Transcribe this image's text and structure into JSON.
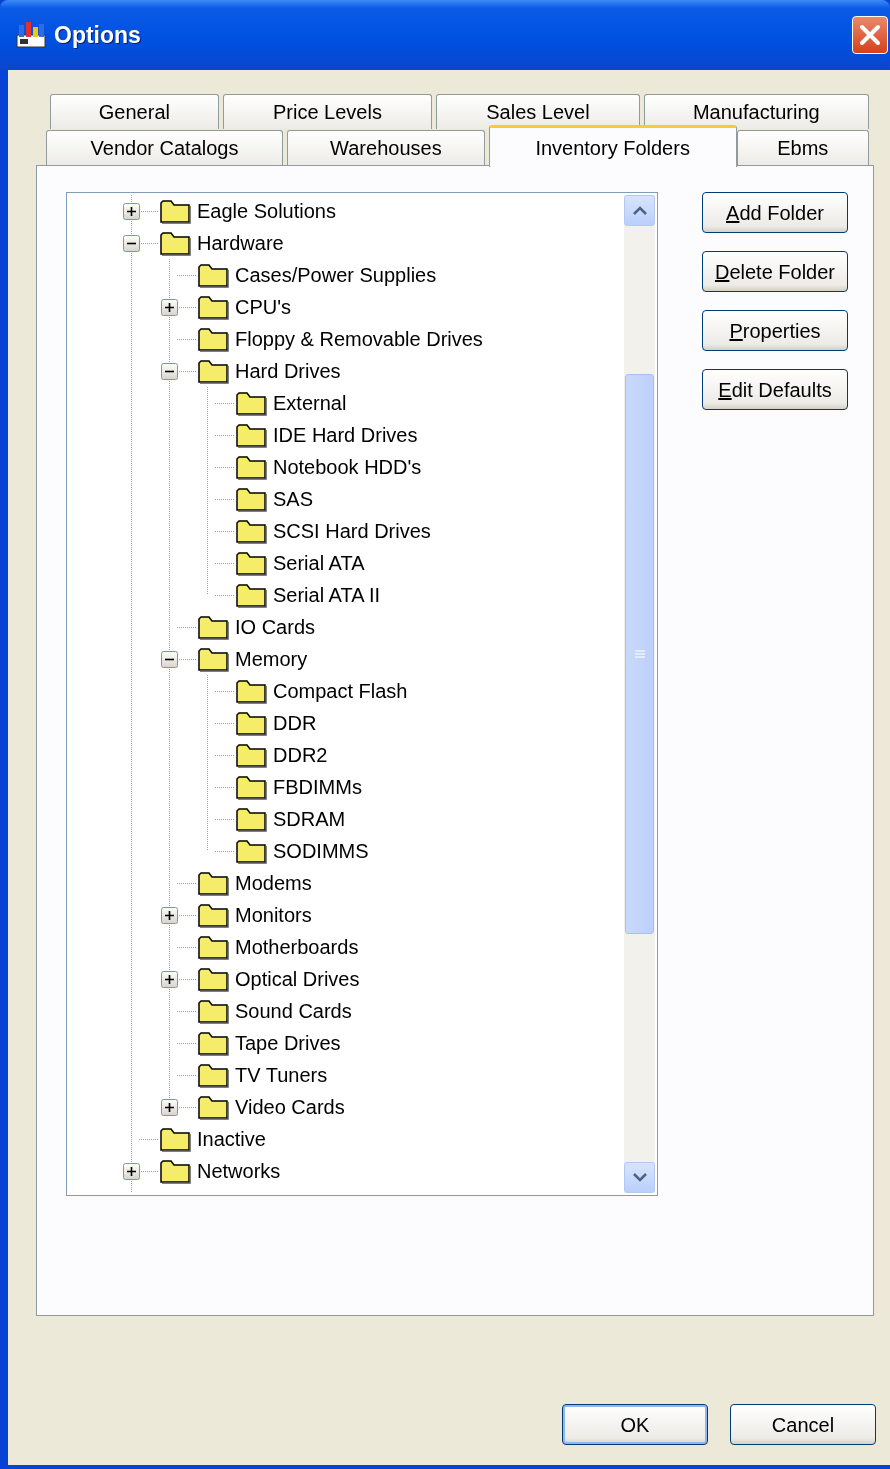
{
  "window": {
    "title": "Options"
  },
  "tab_rows": [
    [
      {
        "label": "General",
        "selected": false
      },
      {
        "label": "Price Levels",
        "selected": false
      },
      {
        "label": "Sales Level",
        "selected": false
      },
      {
        "label": "Manufacturing",
        "selected": false
      }
    ],
    [
      {
        "label": "Vendor Catalogs",
        "selected": false
      },
      {
        "label": "Warehouses",
        "selected": false
      },
      {
        "label": "Inventory Folders",
        "selected": true
      },
      {
        "label": "Ebms",
        "selected": false
      }
    ]
  ],
  "tree": [
    {
      "label": "Eagle Solutions",
      "expanded": false
    },
    {
      "label": "Hardware",
      "expanded": true,
      "children": [
        {
          "label": "Cases/Power Supplies"
        },
        {
          "label": "CPU's",
          "expanded": false
        },
        {
          "label": "Floppy & Removable Drives"
        },
        {
          "label": "Hard Drives",
          "expanded": true,
          "children": [
            {
              "label": "External"
            },
            {
              "label": "IDE Hard Drives"
            },
            {
              "label": "Notebook HDD's"
            },
            {
              "label": "SAS"
            },
            {
              "label": "SCSI Hard Drives"
            },
            {
              "label": "Serial ATA"
            },
            {
              "label": "Serial ATA II"
            }
          ]
        },
        {
          "label": "IO Cards"
        },
        {
          "label": "Memory",
          "expanded": true,
          "children": [
            {
              "label": "Compact Flash"
            },
            {
              "label": "DDR"
            },
            {
              "label": "DDR2"
            },
            {
              "label": "FBDIMMs"
            },
            {
              "label": "SDRAM"
            },
            {
              "label": "SODIMMS"
            }
          ]
        },
        {
          "label": "Modems"
        },
        {
          "label": "Monitors",
          "expanded": false
        },
        {
          "label": "Motherboards"
        },
        {
          "label": "Optical Drives",
          "expanded": false
        },
        {
          "label": "Sound Cards"
        },
        {
          "label": "Tape Drives"
        },
        {
          "label": "TV Tuners"
        },
        {
          "label": "Video Cards",
          "expanded": false
        }
      ]
    },
    {
      "label": "Inactive"
    },
    {
      "label": "Networks",
      "expanded": false
    }
  ],
  "side_buttons": [
    {
      "label": "Add Folder",
      "access_key_underlined": true
    },
    {
      "label": "Delete Folder",
      "access_key_underlined": true
    },
    {
      "label": "Properties",
      "access_key_underlined": true
    },
    {
      "label": "Edit Defaults",
      "access_key_underlined": true
    }
  ],
  "dialog_buttons": [
    {
      "label": "OK",
      "default": true
    },
    {
      "label": "Cancel",
      "default": false
    }
  ]
}
